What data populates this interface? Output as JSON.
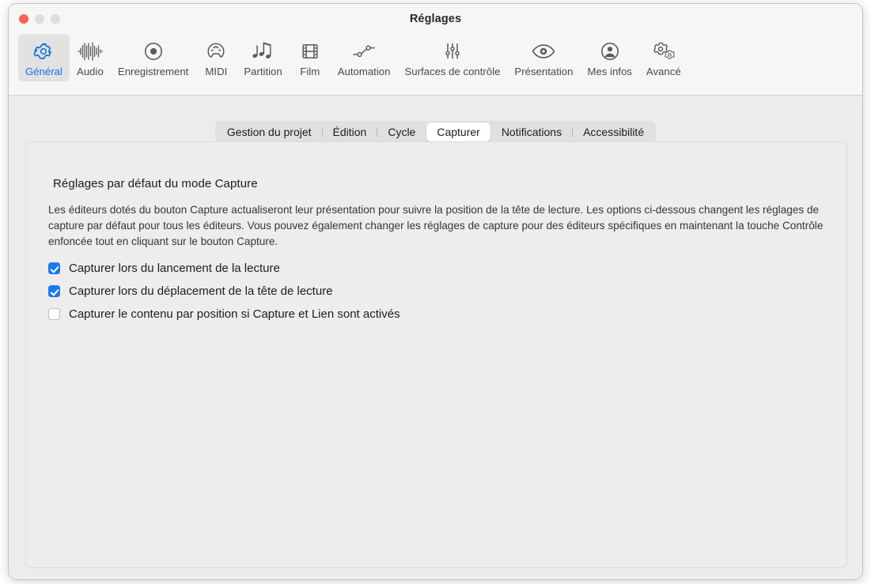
{
  "window": {
    "title": "Réglages",
    "traffic_lights": [
      {
        "name": "close",
        "color": "#ff5f57"
      },
      {
        "name": "minimize",
        "color": "#dddddd"
      },
      {
        "name": "zoom",
        "color": "#dddddd"
      }
    ]
  },
  "toolbar": {
    "selected": "Général",
    "accent_color": "#1274e3",
    "items": [
      {
        "label": "Général",
        "icon": "gear-icon"
      },
      {
        "label": "Audio",
        "icon": "waveform-icon"
      },
      {
        "label": "Enregistrement",
        "icon": "record-circle-icon"
      },
      {
        "label": "MIDI",
        "icon": "midi-connector-icon"
      },
      {
        "label": "Partition",
        "icon": "music-notes-icon"
      },
      {
        "label": "Film",
        "icon": "film-strip-icon"
      },
      {
        "label": "Automation",
        "icon": "automation-nodes-icon"
      },
      {
        "label": "Surfaces de contrôle",
        "icon": "sliders-icon"
      },
      {
        "label": "Présentation",
        "icon": "eye-icon"
      },
      {
        "label": "Mes infos",
        "icon": "person-circle-icon"
      },
      {
        "label": "Avancé",
        "icon": "double-gear-icon"
      }
    ]
  },
  "tabs": {
    "active": "Capturer",
    "items": [
      {
        "label": "Gestion du projet"
      },
      {
        "label": "Édition"
      },
      {
        "label": "Cycle"
      },
      {
        "label": "Capturer"
      },
      {
        "label": "Notifications"
      },
      {
        "label": "Accessibilité"
      }
    ]
  },
  "content": {
    "section_title": "Réglages par défaut du mode Capture",
    "description": "Les éditeurs dotés du bouton Capture actualiseront leur présentation pour suivre la position de la tête de lecture. Les options ci-dessous changent les réglages de capture par défaut pour tous les éditeurs. Vous pouvez également changer les réglages de capture pour des éditeurs spécifiques en maintenant la touche Contrôle enfoncée tout en cliquant sur le bouton Capture.",
    "checkboxes": [
      {
        "label": "Capturer lors du lancement de la lecture",
        "checked": true
      },
      {
        "label": "Capturer lors du déplacement de la tête de lecture",
        "checked": true
      },
      {
        "label": "Capturer le contenu par position si Capture et Lien sont activés",
        "checked": false
      }
    ]
  }
}
